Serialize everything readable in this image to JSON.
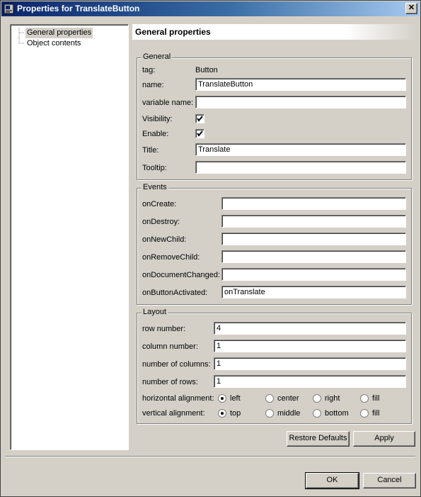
{
  "window": {
    "title": "Properties for TranslateButton",
    "close_glyph": "✕"
  },
  "tree": {
    "items": [
      {
        "label": "General properties",
        "selected": true
      },
      {
        "label": "Object contents",
        "selected": false
      }
    ]
  },
  "page_header": "General properties",
  "general": {
    "legend": "General",
    "tag_label": "tag:",
    "tag_value": "Button",
    "name_label": "name:",
    "name_value": "TranslateButton",
    "varname_label": "variable name:",
    "varname_value": "",
    "visibility_label": "Visibility:",
    "visibility_checked": true,
    "enable_label": "Enable:",
    "enable_checked": true,
    "title_label": "Title:",
    "title_value": "Translate",
    "tooltip_label": "Tooltip:",
    "tooltip_value": ""
  },
  "events": {
    "legend": "Events",
    "rows": [
      {
        "label": "onCreate:",
        "value": ""
      },
      {
        "label": "onDestroy:",
        "value": ""
      },
      {
        "label": "onNewChild:",
        "value": ""
      },
      {
        "label": "onRemoveChild:",
        "value": ""
      },
      {
        "label": "onDocumentChanged:",
        "value": ""
      },
      {
        "label": "onButtonActivated:",
        "value": "onTranslate"
      }
    ]
  },
  "layout": {
    "legend": "Layout",
    "row_number_label": "row number:",
    "row_number_value": "4",
    "column_number_label": "column number:",
    "column_number_value": "1",
    "num_columns_label": "number of columns:",
    "num_columns_value": "1",
    "num_rows_label": "number of rows:",
    "num_rows_value": "1",
    "halign_label": "horizontal alignment:",
    "halign_options": [
      "left",
      "center",
      "right",
      "fill"
    ],
    "halign_selected": "left",
    "valign_label": "vertical alignment:",
    "valign_options": [
      "top",
      "middle",
      "bottom",
      "fill"
    ],
    "valign_selected": "top"
  },
  "buttons": {
    "restore_defaults": "Restore Defaults",
    "apply": "Apply",
    "ok": "OK",
    "cancel": "Cancel"
  },
  "colors": {
    "title_active": "#0a246a",
    "face": "#d4d0c8"
  }
}
